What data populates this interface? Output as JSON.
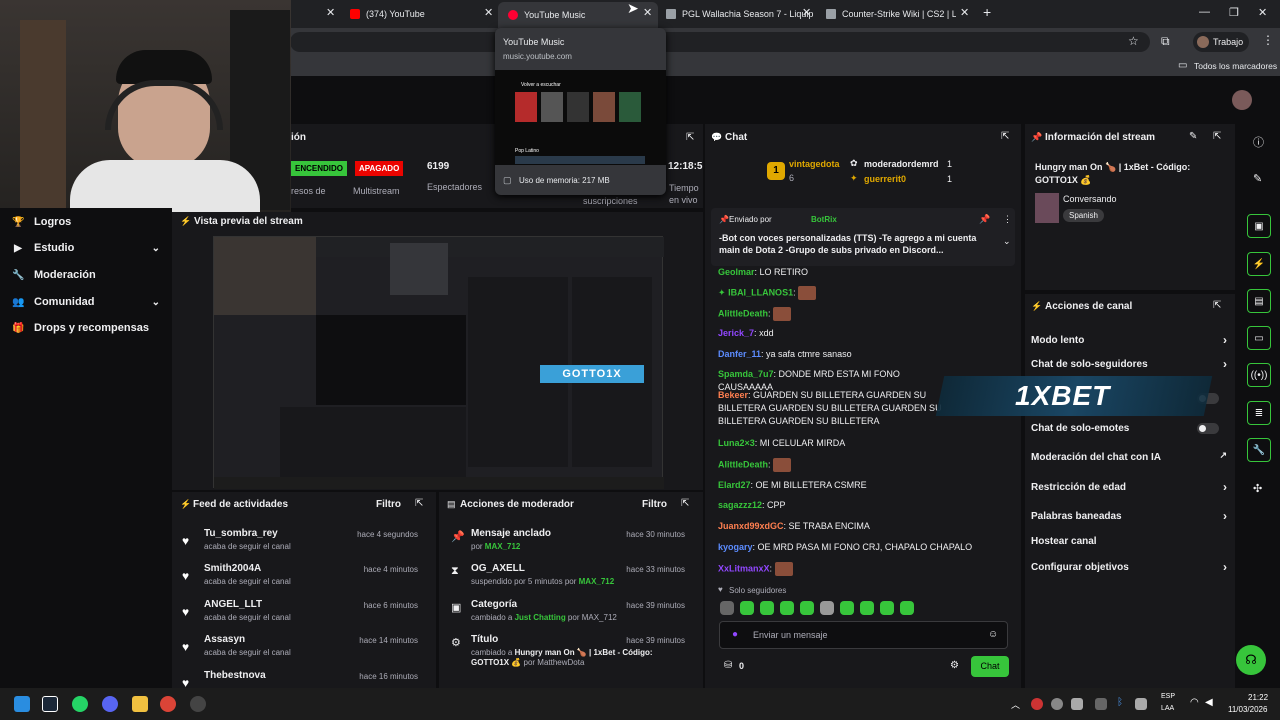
{
  "browser": {
    "tabs": [
      {
        "title": "(374) YouTube",
        "color": "#ff0000"
      },
      {
        "title": "YouTube Music",
        "color": "#ff0033"
      },
      {
        "title": "PGL Wallachia Season 7 - Liquip",
        "color": "#9aa0a6"
      },
      {
        "title": "Counter-Strike Wiki | CS2 | Liqu",
        "color": "#9aa0a6"
      }
    ],
    "new_tab": "+",
    "profile_label": "Trabajo",
    "bookmarks_folder": "Todos los marcadores"
  },
  "tab_tooltip": {
    "title": "YouTube Music",
    "url": "music.youtube.com",
    "preview_heading": "Volver a escuchar",
    "preview_section": "Pop Latino",
    "memory": "Uso de memoria: 217 MB"
  },
  "stats": {
    "section_title": "ión",
    "badge_on": "ENCENDIDO",
    "badge_off": "APAGADO",
    "viewers": "6199",
    "viewers_label": "Espectadores",
    "multistream_label": "Multistream",
    "ingresos_label": "resos de",
    "time": "12:18:5",
    "time_label": "Tiempo en vivo",
    "subs_label": "suscripciones"
  },
  "sidebar": {
    "items": [
      {
        "label": "Logros",
        "icon": "trophy-icon",
        "chevron": false
      },
      {
        "label": "Estudio",
        "icon": "video-icon",
        "chevron": true
      },
      {
        "label": "Moderación",
        "icon": "wrench-icon",
        "chevron": false
      },
      {
        "label": "Comunidad",
        "icon": "people-icon",
        "chevron": true
      },
      {
        "label": "Drops y recompensas",
        "icon": "gift-icon",
        "chevron": false
      }
    ]
  },
  "preview": {
    "title": "Vista previa del stream",
    "overlay_text": "GOTTO1X"
  },
  "feed": {
    "title": "Feed de actividades",
    "filter": "Filtro",
    "items": [
      {
        "name": "Tu_sombra_rey",
        "action": "acaba de seguir el canal",
        "time": "hace 4 segundos"
      },
      {
        "name": "Smith2004A",
        "action": "acaba de seguir el canal",
        "time": "hace 4 minutos"
      },
      {
        "name": "ANGEL_LLT",
        "action": "acaba de seguir el canal",
        "time": "hace 6 minutos"
      },
      {
        "name": "Assasyn",
        "action": "acaba de seguir el canal",
        "time": "hace 14 minutos"
      },
      {
        "name": "Thebestnova",
        "action": "",
        "time": "hace 16 minutos"
      }
    ]
  },
  "modactions": {
    "title": "Acciones de moderador",
    "filter": "Filtro",
    "items": [
      {
        "icon": "pin-icon",
        "name": "Mensaje anclado",
        "pre": "por ",
        "user": "MAX_712",
        "post": "",
        "time": "hace 30 minutos"
      },
      {
        "icon": "hourglass-icon",
        "name": "OG_AXELL",
        "pre": "suspendido por 5 minutos por ",
        "user": "MAX_712",
        "post": "",
        "time": "hace 33 minutos"
      },
      {
        "icon": "category-icon",
        "name": "Categoría",
        "pre": "cambiado a ",
        "user": "Just Chatting",
        "post": " por MAX_712",
        "time": "hace 39 minutos"
      },
      {
        "icon": "title-icon",
        "name": "Título",
        "pre": "cambiado a ",
        "user": "Hungry man On 🍗 | 1xBet - Código: GOTTO1X 💰",
        "post": " por MatthewDota",
        "time": "hace 39 minutos"
      }
    ]
  },
  "chat": {
    "title": "Chat",
    "rank": "1",
    "leader1": {
      "name": "vintagedota",
      "count": "6"
    },
    "leader2": {
      "name": "moderadordemrd",
      "count": "1"
    },
    "leader3": {
      "name": "guerrerit0",
      "count": "1"
    },
    "pinned_by_label": "Enviado por",
    "pinned_by": "BotRix",
    "pinned_text": "-Bot con voces personalizadas (TTS) -Te agrego a mi cuenta main de Dota 2 -Grupo de subs privado en Discord...",
    "messages": [
      {
        "user": "Geolmar",
        "color": "#37c53b",
        "text": "LO RETIRO"
      },
      {
        "user": "IBAI_LLANOS1",
        "color": "#37c53b",
        "text": ""
      },
      {
        "user": "AlittleDeath",
        "color": "#37c53b",
        "text": ""
      },
      {
        "user": "Jerick_7",
        "color": "#9147ff",
        "text": "xdd"
      },
      {
        "user": "Danfer_11",
        "color": "#5c8cff",
        "text": "ya safa ctmre sanaso"
      },
      {
        "user": "Spamda_7u7",
        "color": "#37c53b",
        "text": "DONDE MRD ESTA MI FONO CAUSAAAAA"
      },
      {
        "user": "Bekeer",
        "color": "#ff7f50",
        "text": "GUARDEN SU BILLETERA GUARDEN SU BILLETERA GUARDEN SU BILLETERA GUARDEN SU BILLETERA GUARDEN SU BILLETERA"
      },
      {
        "user": "Luna2×3",
        "color": "#37c53b",
        "text": "MI CELULAR MIRDA"
      },
      {
        "user": "AlittleDeath",
        "color": "#37c53b",
        "text": ""
      },
      {
        "user": "Elard27",
        "color": "#37c53b",
        "text": "OE MI BILLETERA CSMRE"
      },
      {
        "user": "sagazzz12",
        "color": "#37c53b",
        "text": "CPP"
      },
      {
        "user": "Juanxd99xdGC",
        "color": "#ff7f50",
        "text": "SE TRABA ENCIMA"
      },
      {
        "user": "kyogary",
        "color": "#5c8cff",
        "text": "OE MRD PASA MI FONO CRJ, CHAPALO CHAPALO"
      },
      {
        "user": "XxLitmanxX",
        "color": "#9147ff",
        "text": ""
      }
    ],
    "followers_only": "Solo seguidores",
    "input_placeholder": "Enviar un mensaje",
    "points": "0",
    "send": "Chat"
  },
  "streaminfo": {
    "title": "Información del stream",
    "stream_title": "Hungry man On 🍗 | 1xBet - Código: GOTTO1X 💰",
    "category": "Conversando",
    "language": "Spanish"
  },
  "actions": {
    "title": "Acciones de canal",
    "items": [
      {
        "label": "Modo lento",
        "control": "chevron"
      },
      {
        "label": "Chat de solo-seguidores",
        "control": "chevron"
      },
      {
        "label": "Chat de solo-emotes",
        "control": "toggle"
      },
      {
        "label": "Moderación del chat con IA",
        "control": "external"
      },
      {
        "label": "Restricción de edad",
        "control": "chevron"
      },
      {
        "label": "Palabras baneadas",
        "control": "chevron"
      },
      {
        "label": "Hostear canal",
        "control": "none"
      },
      {
        "label": "Configurar objetivos",
        "control": "chevron"
      }
    ],
    "sponsor_overlay": "1XBET"
  },
  "taskbar": {
    "lang": "ESP",
    "lang2": "LAA",
    "time": "21:22",
    "date": "11/03/2026"
  },
  "colors": {
    "accent": "#37c53b",
    "bg": "#0e0e10",
    "panel": "#18181b",
    "live": "#eb0400"
  }
}
